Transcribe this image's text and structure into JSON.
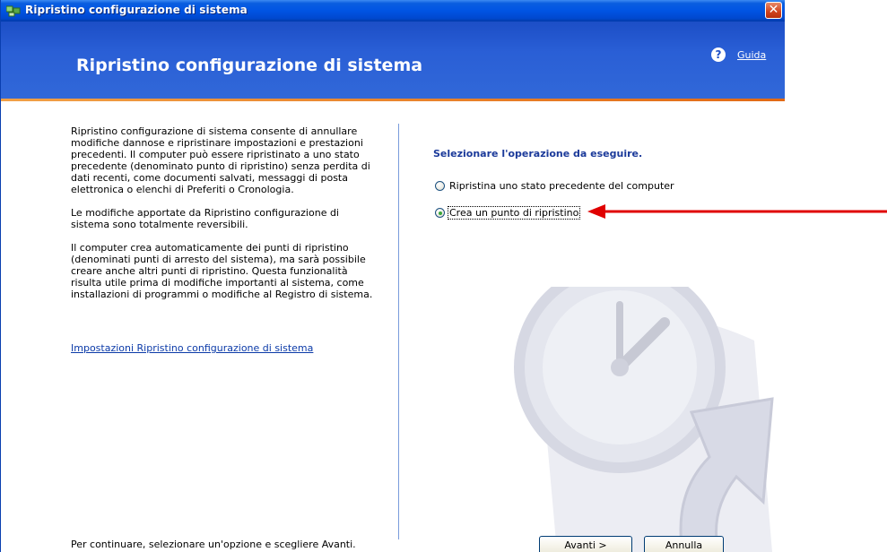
{
  "window": {
    "title": "Ripristino configurazione di sistema",
    "close_glyph": "✕"
  },
  "header": {
    "title": "Ripristino configurazione di sistema",
    "help_icon_glyph": "?",
    "help_link": "Guida"
  },
  "left": {
    "paragraphs": [
      "Ripristino configurazione di sistema consente di annullare modifiche dannose e ripristinare impostazioni e prestazioni precedenti. Il computer può essere ripristinato a uno stato precedente (denominato punto di ripristino) senza perdita di dati recenti, come documenti salvati, messaggi di posta elettronica o elenchi di Preferiti o Cronologia.",
      "Le modifiche apportate da Ripristino configurazione di sistema sono totalmente reversibili.",
      "Il computer crea automaticamente dei punti di ripristino (denominati punti di arresto del sistema), ma sarà possibile creare anche altri punti di ripristino. Questa funzionalità risulta utile prima di modifiche importanti al sistema, come installazioni di programmi o modifiche al Registro di sistema."
    ],
    "settings_link": "Impostazioni Ripristino configurazione di sistema",
    "footer": "Per continuare, selezionare un'opzione e scegliere Avanti."
  },
  "right": {
    "prompt": "Selezionare l'operazione da eseguire.",
    "options": [
      {
        "label": "Ripristina uno stato precedente del computer",
        "checked": false
      },
      {
        "label": "Crea un punto di ripristino",
        "checked": true
      }
    ]
  },
  "buttons": {
    "next": "Avanti >",
    "cancel": "Annulla"
  },
  "colors": {
    "titlebar": "#0054e3",
    "header": "#2a5fd6",
    "accent_line": "#e26a15",
    "annotation_arrow": "#e00000"
  },
  "icons": [
    "system-restore-app-icon",
    "close-icon",
    "help-icon",
    "clock-watermark-icon",
    "red-arrow-annotation"
  ]
}
